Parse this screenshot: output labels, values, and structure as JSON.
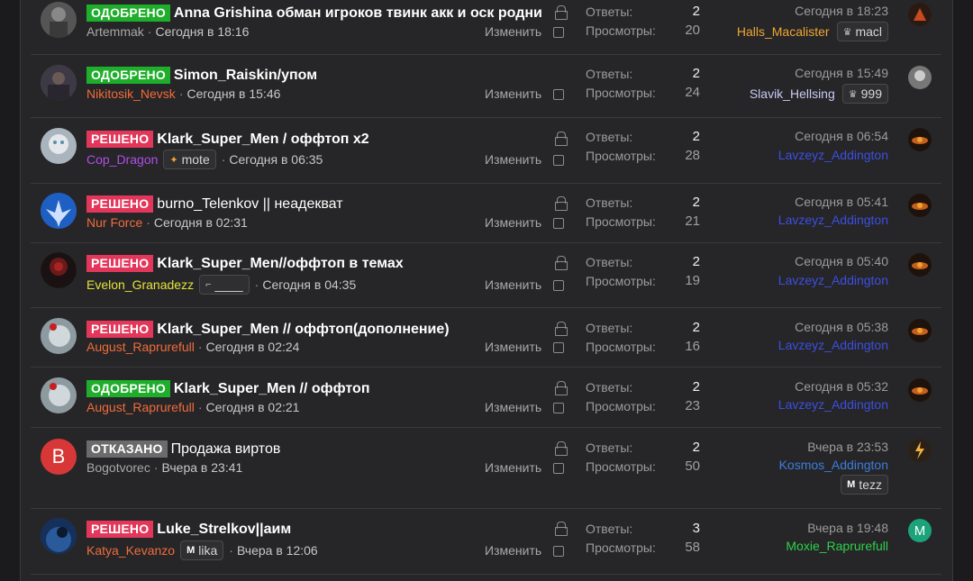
{
  "labels": {
    "replies": "Ответы:",
    "views": "Просмотры:",
    "edit": "Изменить"
  },
  "threads": [
    {
      "status": "ОДОБРЕНО",
      "status_color": "#1fae2b",
      "title": "Anna Grishina обман игроков твинк акк и оск родни",
      "author": "Artemmak",
      "author_color": "#a8a8a8",
      "date": "Сегодня в 18:16",
      "replies": "2",
      "views": "20",
      "last_date": "Сегодня в 18:23",
      "last_user": "Halls_Macalister",
      "last_user_color": "#f0a531",
      "last_user_badge": "macl",
      "locked": true
    },
    {
      "status": "ОДОБРЕНО",
      "status_color": "#1fae2b",
      "title": "Simon_Raiskin/упом",
      "author": "Nikitosik_Nevsk",
      "author_color": "#f26b3a",
      "date": "Сегодня в 15:46",
      "replies": "2",
      "views": "24",
      "last_date": "Сегодня в 15:49",
      "last_user": "Slavik_Hellsing",
      "last_user_color": "#c9c9f5",
      "last_user_badge": "999",
      "locked": false
    },
    {
      "status": "РЕШЕНО",
      "status_color": "#e2375a",
      "title": "Klark_Super_Men / оффтоп x2",
      "author": "Cop_Dragon",
      "author_color": "#b04de8",
      "author_badge": "mote",
      "date": "Сегодня в 06:35",
      "replies": "2",
      "views": "28",
      "last_date": "Сегодня в 06:54",
      "last_user": "Lavzeyz_Addington",
      "last_user_color": "#3c4fe0",
      "locked": true
    },
    {
      "status": "РЕШЕНО",
      "status_color": "#e2375a",
      "title": "burno_Telenkov || неадекват",
      "author": "Nur Force",
      "author_color": "#f26b3a",
      "date": "Сегодня в 02:31",
      "replies": "2",
      "views": "21",
      "last_date": "Сегодня в 05:41",
      "last_user": "Lavzeyz_Addington",
      "last_user_color": "#3c4fe0",
      "locked": true
    },
    {
      "status": "РЕШЕНО",
      "status_color": "#e2375a",
      "title": "Klark_Super_Men//оффтоп в темах",
      "author": "Evelon_Granadezz",
      "author_color": "#e6e23a",
      "author_badge": "____",
      "date": "Сегодня в 04:35",
      "replies": "2",
      "views": "19",
      "last_date": "Сегодня в 05:40",
      "last_user": "Lavzeyz_Addington",
      "last_user_color": "#3c4fe0",
      "locked": true
    },
    {
      "status": "РЕШЕНО",
      "status_color": "#e2375a",
      "title": "Klark_Super_Men // оффтоп(дополнение)",
      "author": "August_Raprurefull",
      "author_color": "#f26b3a",
      "date": "Сегодня в 02:24",
      "replies": "2",
      "views": "16",
      "last_date": "Сегодня в 05:38",
      "last_user": "Lavzeyz_Addington",
      "last_user_color": "#3c4fe0",
      "locked": true
    },
    {
      "status": "ОДОБРЕНО",
      "status_color": "#1fae2b",
      "title": "Klark_Super_Men // оффтоп",
      "author": "August_Raprurefull",
      "author_color": "#f26b3a",
      "date": "Сегодня в 02:21",
      "replies": "2",
      "views": "23",
      "last_date": "Сегодня в 05:32",
      "last_user": "Lavzeyz_Addington",
      "last_user_color": "#3c4fe0",
      "locked": true
    },
    {
      "status": "ОТКАЗАНО",
      "status_color": "#6b6b6b",
      "title": "Продажа виртов",
      "author": "Bogotvorec",
      "author_color": "#a8a8a8",
      "date": "Вчера в 23:41",
      "replies": "2",
      "views": "50",
      "last_date": "Вчера в 23:53",
      "last_user": "Kosmos_Addington",
      "last_user_color": "#3c7de0",
      "last_user_badge": "tezz",
      "avatar_letter": "B",
      "locked": true
    },
    {
      "status": "РЕШЕНО",
      "status_color": "#e2375a",
      "title": "Luke_Strelkov||аим",
      "author": "Katya_Kevanzo",
      "author_color": "#f26b3a",
      "author_badge": "lika",
      "date": "Вчера в 12:06",
      "replies": "3",
      "views": "58",
      "last_date": "Вчера в 19:48",
      "last_user": "Moxie_Raprurefull",
      "last_user_color": "#2dd14a",
      "mini_avatar_letter": "M",
      "locked": true
    }
  ]
}
